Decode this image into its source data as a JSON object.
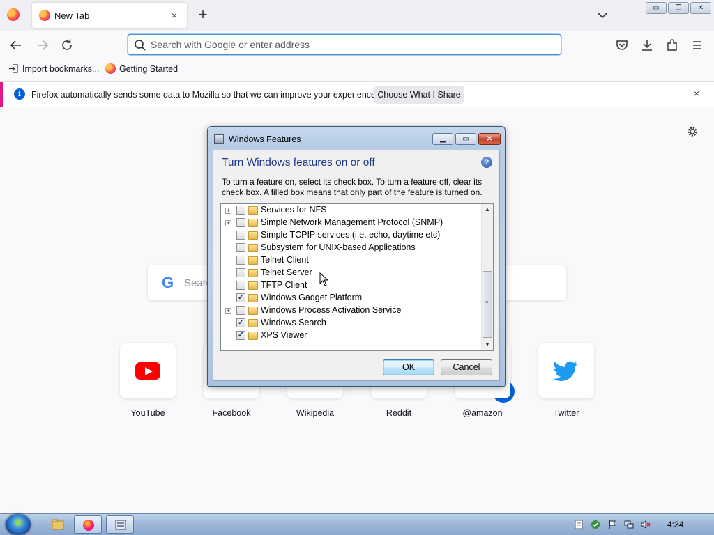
{
  "browser": {
    "tab": {
      "title": "New Tab",
      "close": "×"
    },
    "new_tab": "+",
    "window_controls": {
      "minimize": "▭",
      "restore": "❐",
      "close": "✕"
    },
    "url_placeholder": "Search with Google or enter address",
    "bookmarks": [
      {
        "label": "Import bookmarks..."
      },
      {
        "label": "Getting Started"
      }
    ],
    "notification": {
      "text": "Firefox automatically sends some data to Mozilla so that we can improve your experience.",
      "button": "Choose What I Share",
      "close": "×"
    }
  },
  "new_tab_page": {
    "search_text": "Searc",
    "shortcuts": [
      {
        "label": "YouTube"
      },
      {
        "label": "Facebook"
      },
      {
        "label": "Wikipedia"
      },
      {
        "label": "Reddit"
      },
      {
        "label": "@amazon"
      },
      {
        "label": "Twitter"
      }
    ]
  },
  "dialog": {
    "title": "Windows Features",
    "heading": "Turn Windows features on or off",
    "help": "?",
    "description": "To turn a feature on, select its check box. To turn a feature off, clear its check box. A filled box means that only part of the feature is turned on.",
    "features": [
      {
        "label": "Services for NFS",
        "expandable": true,
        "checked": false
      },
      {
        "label": "Simple Network Management Protocol (SNMP)",
        "expandable": true,
        "checked": false
      },
      {
        "label": "Simple TCPIP services (i.e. echo, daytime etc)",
        "expandable": false,
        "checked": false
      },
      {
        "label": "Subsystem for UNIX-based Applications",
        "expandable": false,
        "checked": false
      },
      {
        "label": "Telnet Client",
        "expandable": false,
        "checked": false
      },
      {
        "label": "Telnet Server",
        "expandable": false,
        "checked": false
      },
      {
        "label": "TFTP Client",
        "expandable": false,
        "checked": false
      },
      {
        "label": "Windows Gadget Platform",
        "expandable": false,
        "checked": true
      },
      {
        "label": "Windows Process Activation Service",
        "expandable": true,
        "checked": false
      },
      {
        "label": "Windows Search",
        "expandable": false,
        "checked": true
      },
      {
        "label": "XPS Viewer",
        "expandable": false,
        "checked": true
      }
    ],
    "ok": "OK",
    "cancel": "Cancel"
  },
  "taskbar": {
    "clock": "4:34"
  },
  "colors": {
    "accent": "#0060df",
    "notification_accent": "#e31587",
    "dialog_heading": "#1e3a8a",
    "twitter": "#1d9bf0",
    "youtube": "#ff0000"
  }
}
